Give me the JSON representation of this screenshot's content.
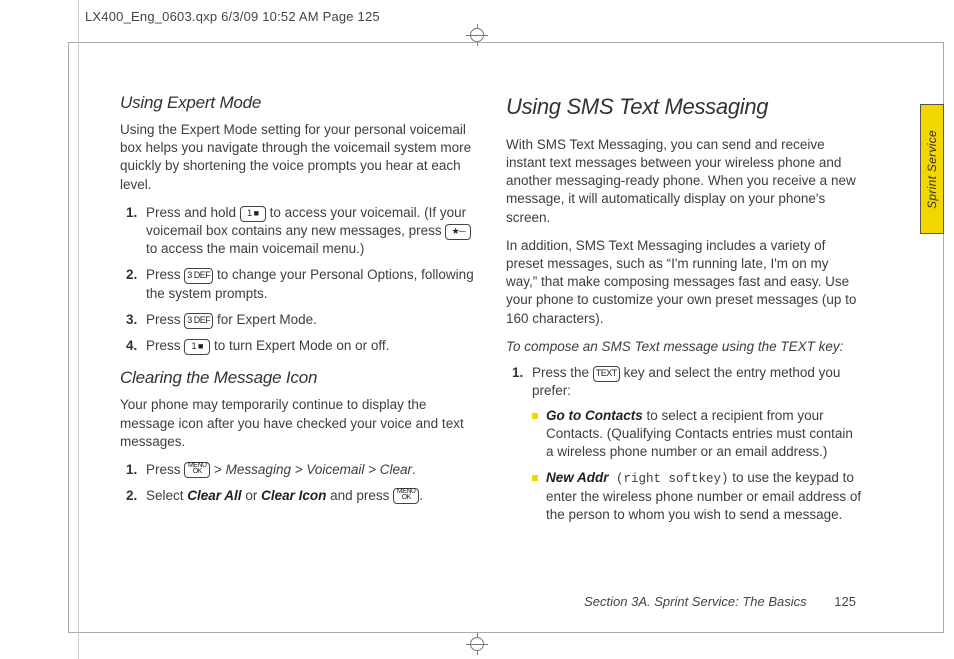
{
  "print_header": "LX400_Eng_0603.qxp  6/3/09  10:52 AM  Page 125",
  "side_tab": "Sprint Service",
  "left": {
    "h_expert": "Using Expert Mode",
    "p_expert": "Using the Expert Mode setting for your personal voicemail box helps you navigate through the voicemail system more quickly by shortening the voice prompts you hear at each level.",
    "steps_expert": {
      "s1a": "Press and hold ",
      "s1b": " to access your voicemail. (If your voicemail box contains any new messages, press ",
      "s1c": " to access the main voicemail menu.)",
      "s2a": "Press ",
      "s2b": " to change your Personal Options, following the system prompts.",
      "s3a": "Press ",
      "s3b": " for Expert Mode.",
      "s4a": "Press ",
      "s4b": " to turn Expert Mode on or off."
    },
    "h_clear": "Clearing the Message Icon",
    "p_clear": "Your phone may temporarily continue to display the message icon after you have checked your voice and text messages.",
    "steps_clear": {
      "s1a": "Press ",
      "s1b": " > ",
      "path1": "Messaging > Voicemail > Clear",
      "s1c": ".",
      "s2a": "Select ",
      "kw1": "Clear All",
      "s2b": " or ",
      "kw2": "Clear Icon",
      "s2c": " and press ",
      "s2d": "."
    }
  },
  "right": {
    "h_sms": "Using SMS Text Messaging",
    "p1": "With SMS Text Messaging, you can send and receive instant text messages between your wireless phone and another messaging-ready phone. When you receive a new message, it will automatically display on your phone's screen.",
    "p2": "In addition, SMS Text Messaging includes a variety of preset messages, such as “I'm running late, I'm on my way,” that make composing messages fast and easy. Use your phone to customize your own preset messages (up to 160 characters).",
    "sub": "To compose an SMS Text message using the TEXT key:",
    "step1a": "Press the ",
    "step1b": " key and select the entry method you prefer:",
    "bullets": {
      "b1_kw": "Go to Contacts",
      "b1_txt": " to select a recipient from your Contacts. (Qualifying Contacts entries must contain a wireless phone number or an email address.)",
      "b2_kw": "New Addr",
      "b2_soft": " (right softkey)",
      "b2_txt": " to use the keypad to enter the wireless phone number or email address of the person to whom you wish to send a message."
    }
  },
  "keys": {
    "one": "1 ■",
    "star": "★─",
    "three": "3 DEF",
    "ok_top": "MENU",
    "ok_bot": "OK",
    "text": "TEXT"
  },
  "footer": {
    "section": "Section 3A. Sprint Service: The Basics",
    "page": "125"
  }
}
